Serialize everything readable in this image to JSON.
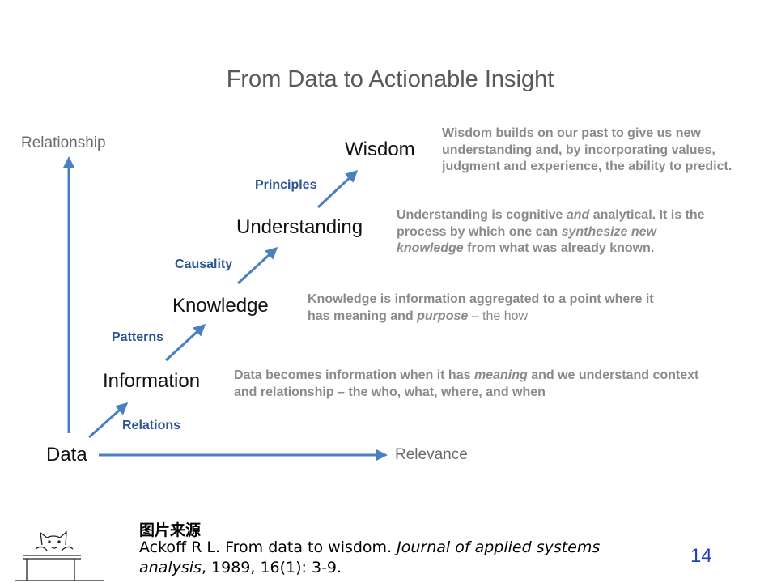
{
  "slide": {
    "title": "From Data to Actionable Insight",
    "page_number": "14"
  },
  "axes": {
    "y_label": "Relationship",
    "x_label": "Relevance"
  },
  "stages": {
    "data": "Data",
    "information": "Information",
    "knowledge": "Knowledge",
    "understanding": "Understanding",
    "wisdom": "Wisdom"
  },
  "connectors": {
    "relations": "Relations",
    "patterns": "Patterns",
    "causality": "Causality",
    "principles": "Principles"
  },
  "descriptions": {
    "information": {
      "p1": "Data becomes information when it has ",
      "em1": "meaning",
      "p2": " and we understand context and relationship – the who, what, where, and when"
    },
    "knowledge": {
      "p1": "Knowledge is information aggregated to a point where it has meaning and ",
      "em1": "purpose",
      "tail": " – the how"
    },
    "understanding": {
      "p1": "Understanding is cognitive ",
      "em1": "and",
      "p2": " analytical. It is the process by which one can ",
      "em2": "synthesize new knowledge",
      "p3": " from what was already known."
    },
    "wisdom": {
      "text": "Wisdom builds on our past to give us new understanding and, by incorporating values, judgment and experience, the ability to predict."
    }
  },
  "reference": {
    "heading": "图片来源",
    "p1": "Ackoff R L. From data to wisdom. ",
    "journal": "Journal of applied systems analysis",
    "p2": ", 1989, 16(1): 3-9."
  },
  "colors": {
    "arrow": "#4a7fc1",
    "connector_text": "#2b5591",
    "description_text": "#8a8a8a",
    "page_number": "#1f3fbf"
  }
}
